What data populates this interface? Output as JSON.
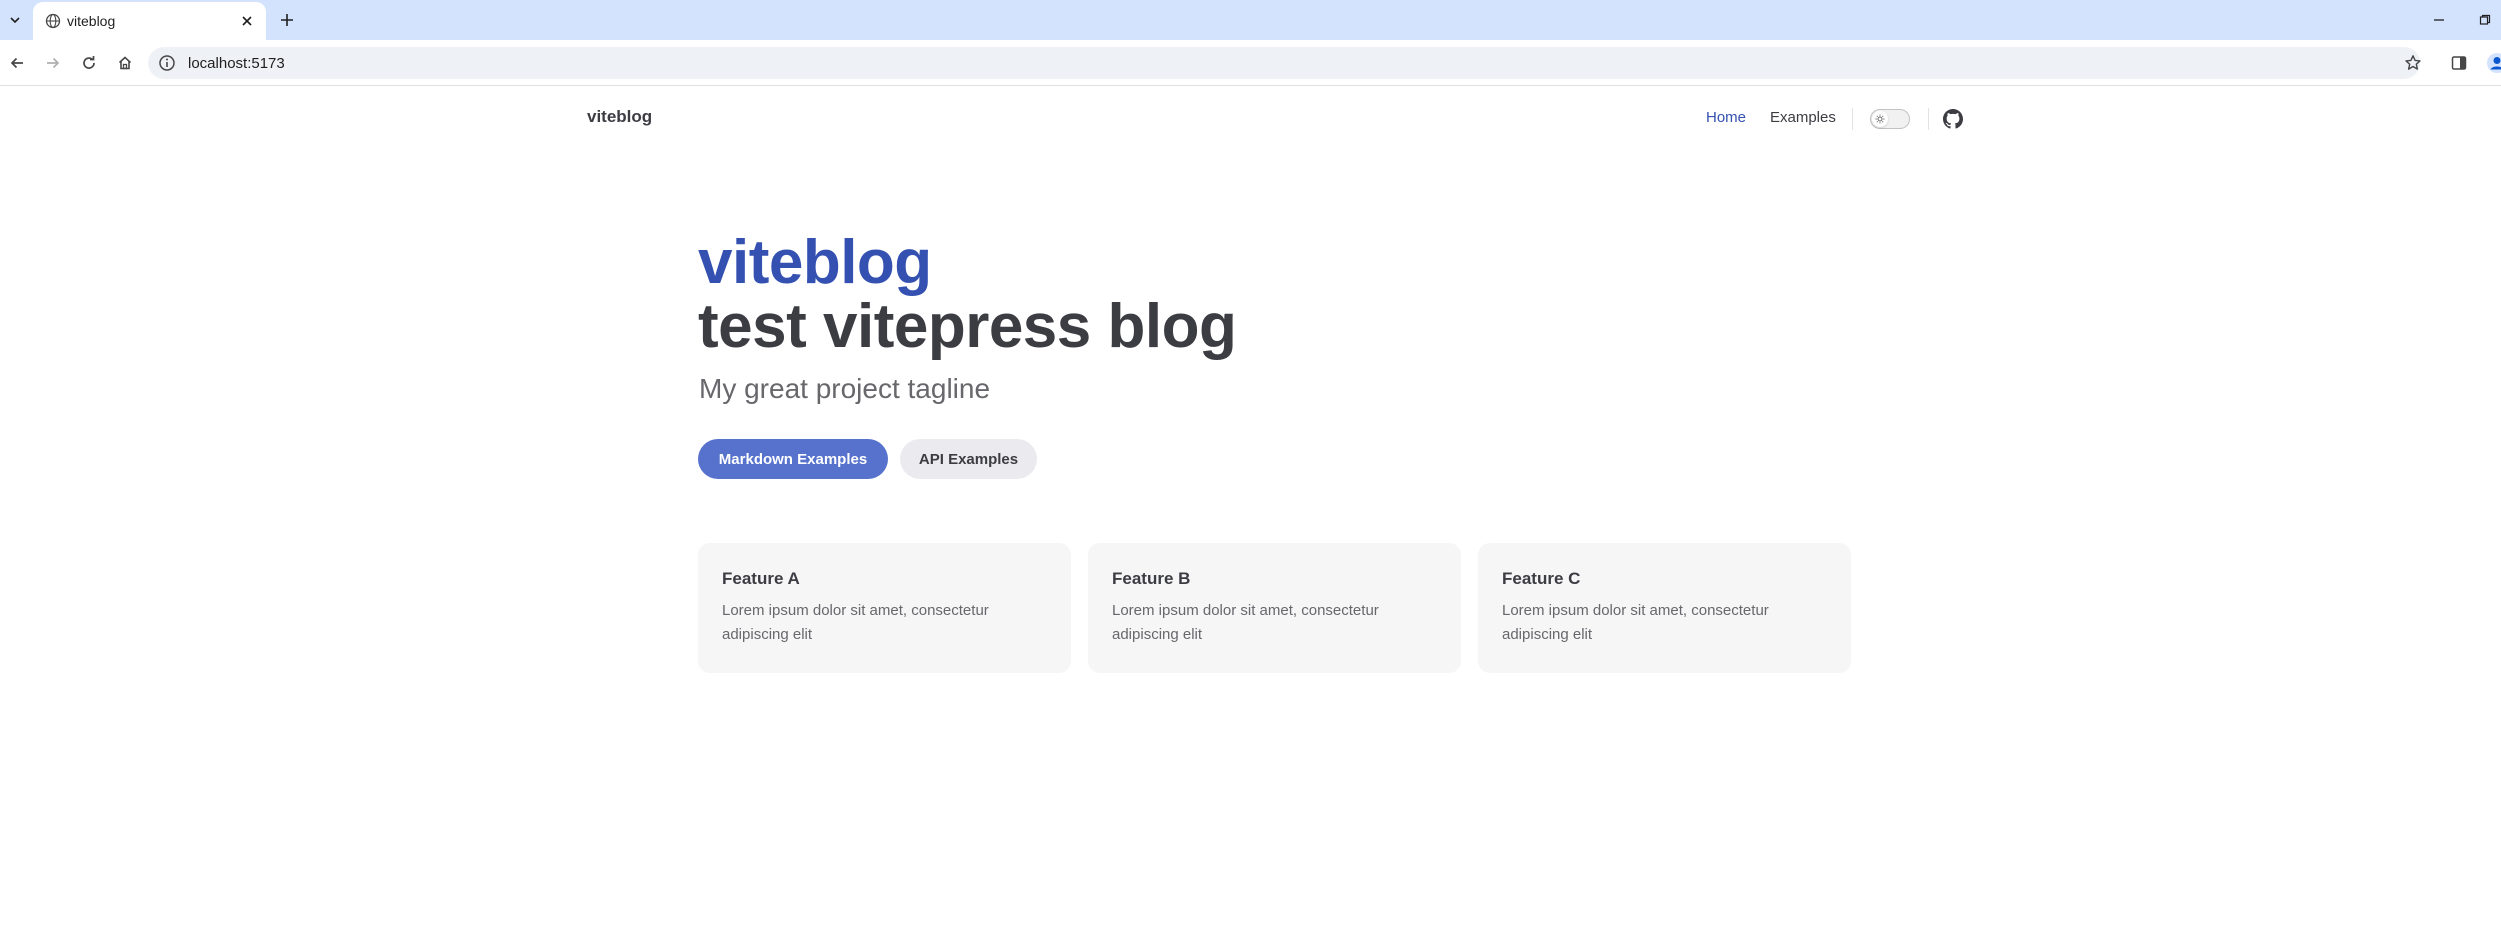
{
  "browser": {
    "tab_title": "viteblog",
    "url": "localhost:5173",
    "colors": {
      "tabstrip": "#d3e3fd",
      "omnibox": "#eef1f6"
    }
  },
  "nav": {
    "title": "viteblog",
    "links": [
      {
        "label": "Home",
        "active": true
      },
      {
        "label": "Examples",
        "active": false
      }
    ]
  },
  "hero": {
    "name": "viteblog",
    "text": "test vitepress blog",
    "tagline": "My great project tagline",
    "actions": [
      {
        "label": "Markdown Examples",
        "theme": "brand"
      },
      {
        "label": "API Examples",
        "theme": "alt"
      }
    ]
  },
  "features": [
    {
      "title": "Feature A",
      "details": "Lorem ipsum dolor sit amet, consectetur adipiscing elit"
    },
    {
      "title": "Feature B",
      "details": "Lorem ipsum dolor sit amet, consectetur adipiscing elit"
    },
    {
      "title": "Feature C",
      "details": "Lorem ipsum dolor sit amet, consectetur adipiscing elit"
    }
  ],
  "colors": {
    "brand": "#3451b2",
    "brand_button": "#5672cd",
    "text": "#3c3c43",
    "muted": "#67676c",
    "feature_bg": "#f6f6f7"
  }
}
